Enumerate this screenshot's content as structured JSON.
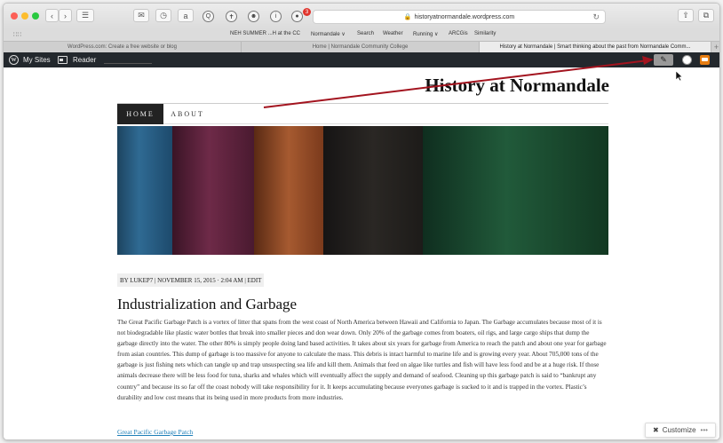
{
  "browser": {
    "url": "historyatnormandale.wordpress.com",
    "extension_badge_count": "3",
    "bookmarks": [
      "NEH SUMMER ...H at the CC",
      "Normandale ∨",
      "Search",
      "Weather",
      "Running ∨",
      "ARCGis",
      "Similarity"
    ],
    "tabs": [
      "WordPress.com: Create a free website or blog",
      "Home | Normandale Community College",
      "History at Normandale | Smart thinking about the past from Normandale Comm..."
    ],
    "active_tab_index": 2,
    "icons": {
      "back": "chevron-left-icon",
      "forward": "chevron-right-icon",
      "reload": "reload-icon",
      "share": "share-icon",
      "tabs_overview": "tabs-overview-icon",
      "lock": "lock-icon"
    }
  },
  "admin_bar": {
    "my_sites": "My Sites",
    "reader": "Reader",
    "write_icon": "pencil-icon",
    "notifications_color": "#e77d11"
  },
  "site": {
    "title": "History at Normandale",
    "nav": [
      "HOME",
      "ABOUT"
    ],
    "active_nav": "HOME"
  },
  "post": {
    "meta": "BY LUKEP7 | NOVEMBER 15, 2015 · 2:04 AM | EDIT",
    "title": "Industrialization and Garbage",
    "body": "The Great Pacific Garbage Patch is a vortex of litter that spans from the west coast of North America between Hawaii and California to Japan. The Garbage accumulates because most of it is not biodegradable like plastic water bottles that break into smaller pieces and don wear down. Only 20% of the garbage comes from boaters, oil rigs, and large cargo ships that dump the garbage directly into the water. The other 80% is simply people doing land based activities. It takes about six years for garbage from America to reach the patch and about one year for garbage from asian countries. This dump of garbage is too massive for anyone to calculate the mass. This debris is intact harmful to marine life and is growing every year. About 705,000 tons of the garbage is just fishing nets which can tangle up and trap unsuspecting sea life and kill them. Animals that feed on algae like turtles and fish will have less food and be at a huge risk. If those animals decrease there will be less food for tuna, sharks and whales which will eventually affect the supply and demand of seafood. Cleaning up this garbage patch is said to “bankrupt any country” and because its so far off the coast nobody will take responsibility for it. It keeps accumulating because everyones garbage is sucked to it and is trapped in the vortex.  Plastic’s durability and low cost means that its being used in more products from more industries.",
    "link": "Great Pacific Garbage Patch"
  },
  "customize": {
    "label": "Customize",
    "more": "•••"
  },
  "annotation": {
    "arrow_color": "#a3141f"
  }
}
